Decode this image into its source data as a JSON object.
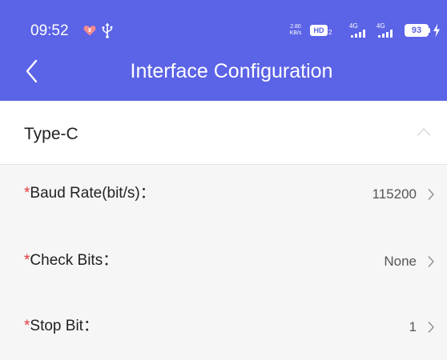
{
  "status_bar": {
    "time": "09:52",
    "net_speed_value": "2.80",
    "net_speed_unit": "KB/s",
    "hd_label": "HD",
    "hd_sub": "2",
    "signal_1_label": "4G",
    "signal_2_label": "4G",
    "battery_level": "93",
    "icons": [
      "heart-icon",
      "usb-icon",
      "signal-icon",
      "battery-icon",
      "charging-bolt-icon"
    ]
  },
  "nav": {
    "title": "Interface Configuration",
    "back_icon": "chevron-left-icon"
  },
  "section": {
    "title": "Type-C",
    "expanded": true,
    "toggle_icon": "chevron-up-icon"
  },
  "settings": [
    {
      "required_mark": "*",
      "label": "Baud Rate(bit/s)：",
      "value": "115200"
    },
    {
      "required_mark": "*",
      "label": "Check Bits：",
      "value": "None"
    },
    {
      "required_mark": "*",
      "label": "Stop Bit：",
      "value": "1"
    }
  ],
  "colors": {
    "header_bg": "#5b63e6",
    "required_mark": "#e5393c",
    "page_bg": "#f6f6f6"
  }
}
